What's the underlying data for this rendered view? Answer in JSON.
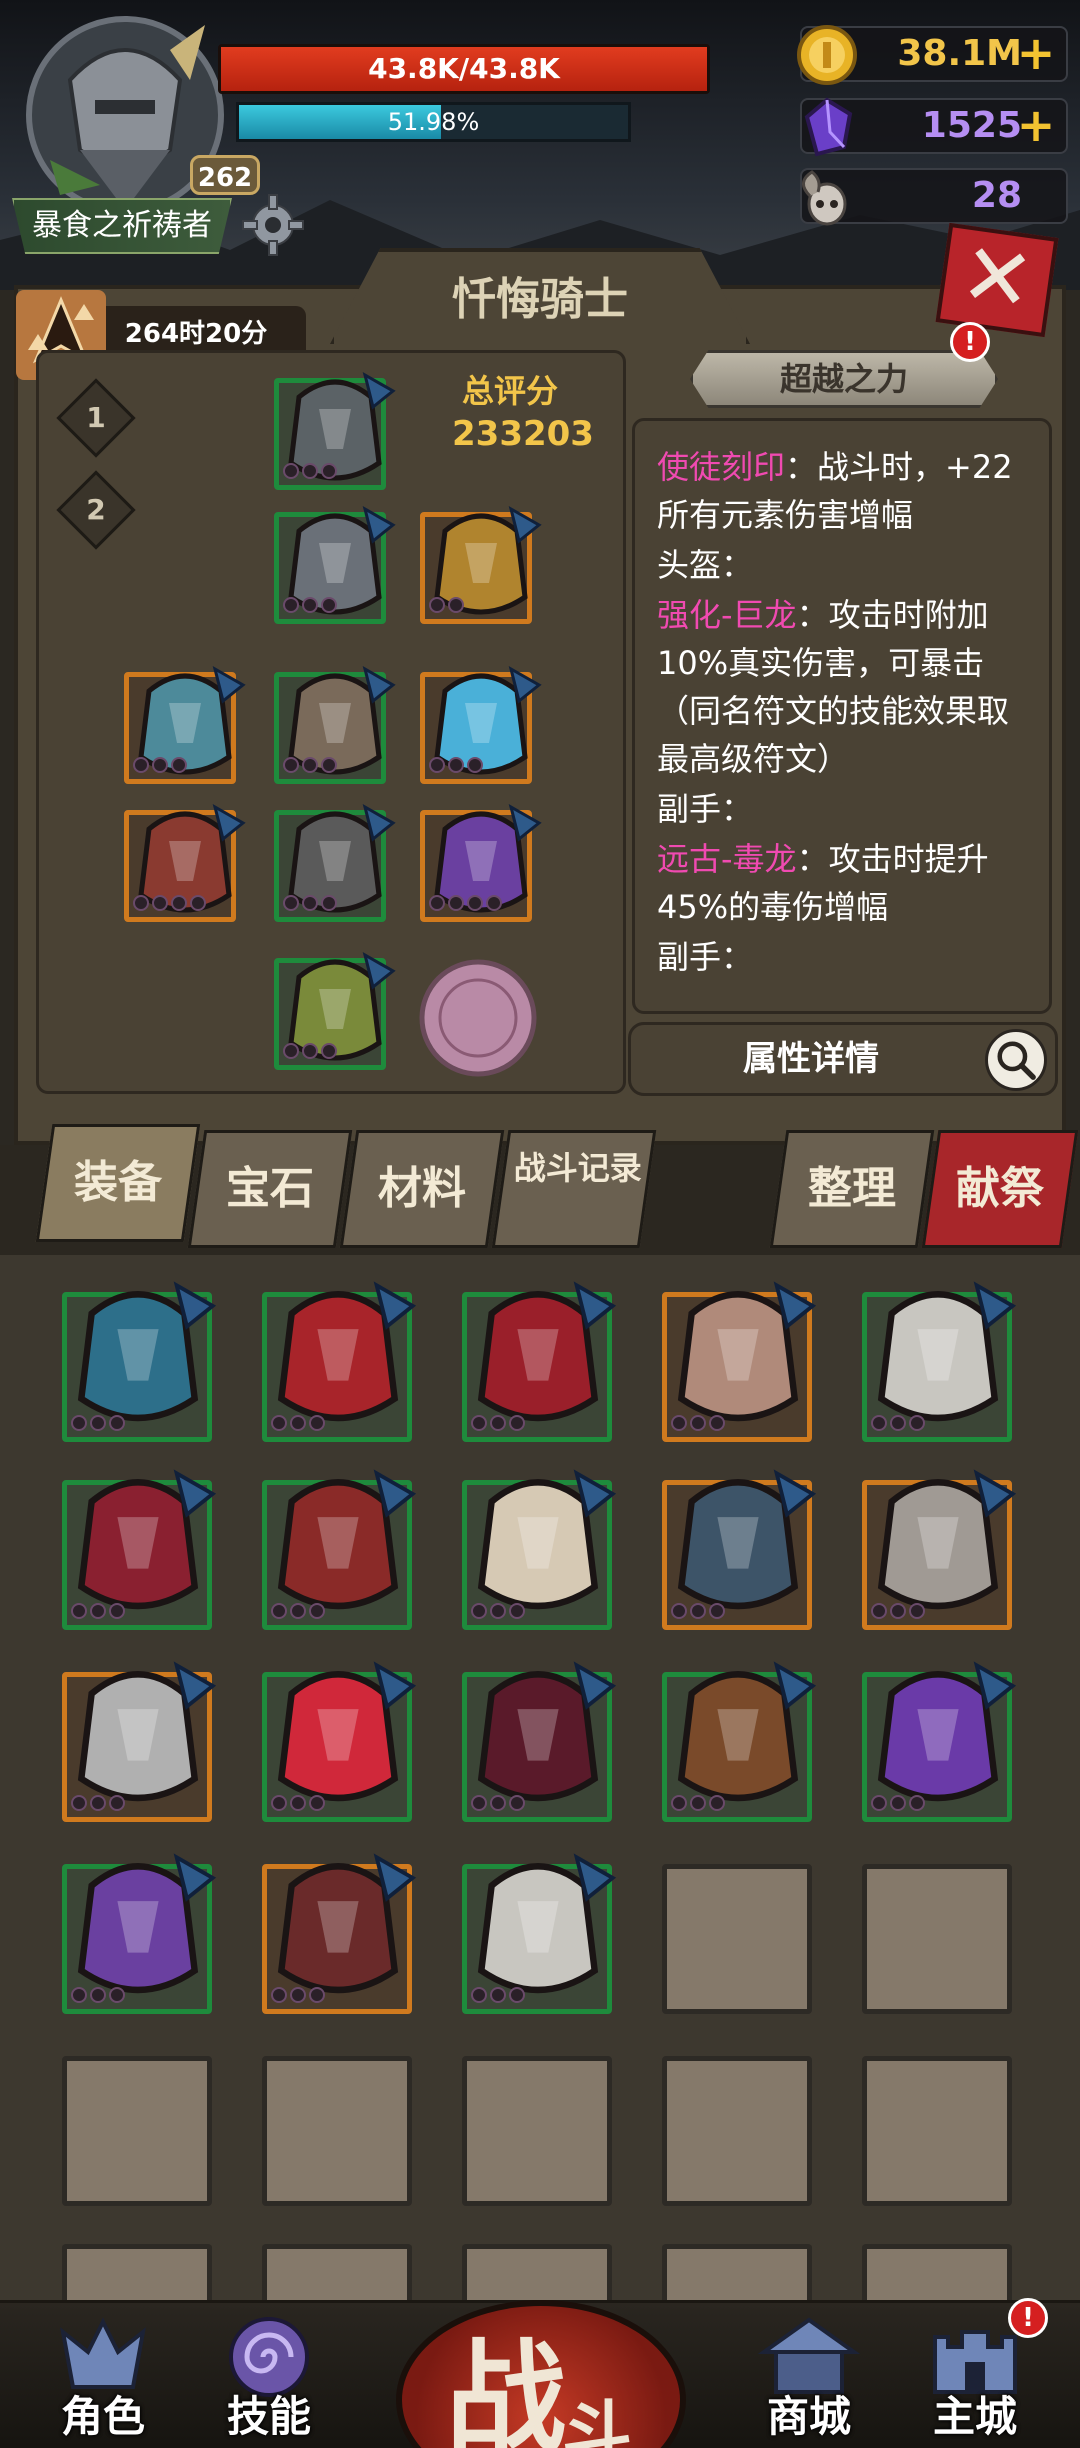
{
  "player": {
    "hp_text": "43.8K/43.8K",
    "hp_fraction": 1.0,
    "xp_text": "51.98%",
    "xp_fraction": 0.5198,
    "level": "262",
    "title": "暴食之祈祷者"
  },
  "currencies": [
    {
      "icon": "gold-coin-icon",
      "value": "38.1M",
      "color": "#f2c54a",
      "has_plus": true
    },
    {
      "icon": "purple-crystal-icon",
      "value": "1525",
      "color": "#b58ef2",
      "has_plus": true
    },
    {
      "icon": "ram-skull-icon",
      "value": "28",
      "color": "#b58ef2",
      "has_plus": false
    }
  ],
  "panel": {
    "title": "忏悔骑士",
    "timer": "264时20分",
    "presets": [
      "1",
      "2"
    ],
    "score_label": "总评分",
    "score_value": "233203",
    "transcend_label": "超越之力",
    "transcend_alert": "!",
    "attr_detail_label": "属性详情"
  },
  "desc": {
    "lines": [
      {
        "hl": "使徒刻印",
        "text": "：战斗时，+22所有元素伤害增幅"
      },
      {
        "hl": "",
        "text": "头盔："
      },
      {
        "hl": "强化-巨龙",
        "text": "：攻击时附加10%真实伤害，可暴击（同名符文的技能效果取最高级符文）"
      },
      {
        "hl": "",
        "text": "副手："
      },
      {
        "hl": "远古-毒龙",
        "text": "：攻击时提升45%的毒伤增幅"
      },
      {
        "hl": "",
        "text": "副手："
      }
    ]
  },
  "tabs": [
    {
      "label": "装备",
      "active": true
    },
    {
      "label": "宝石",
      "active": false
    },
    {
      "label": "材料",
      "active": false
    },
    {
      "label": "战斗记录",
      "active": false
    },
    {
      "label": "整理",
      "active": false
    },
    {
      "label": "献祭",
      "active": false
    }
  ],
  "inventory": {
    "rows": [
      [
        {
          "item": "blue-tome",
          "rarity": "green"
        },
        {
          "item": "red-tome",
          "rarity": "green"
        },
        {
          "item": "red-pauldrons",
          "rarity": "green"
        },
        {
          "item": "pearl-necklace",
          "rarity": "orange"
        },
        {
          "item": "steel-boots",
          "rarity": "green"
        }
      ],
      [
        {
          "item": "dragon-helm",
          "rarity": "green"
        },
        {
          "item": "dragon-armor",
          "rarity": "green"
        },
        {
          "item": "bone-armor",
          "rarity": "green"
        },
        {
          "item": "dragon-gauntlet",
          "rarity": "orange"
        },
        {
          "item": "ram-skull-helm",
          "rarity": "orange"
        }
      ],
      [
        {
          "item": "fire-axe",
          "rarity": "orange"
        },
        {
          "item": "crimson-star",
          "rarity": "green"
        },
        {
          "item": "dark-pauldrons",
          "rarity": "green"
        },
        {
          "item": "flame-belt",
          "rarity": "green"
        },
        {
          "item": "purple-helm",
          "rarity": "green"
        }
      ],
      [
        {
          "item": "void-boots",
          "rarity": "green"
        },
        {
          "item": "dragon-shield",
          "rarity": "orange"
        },
        {
          "item": "steel-greaves",
          "rarity": "green"
        },
        {
          "item": "",
          "rarity": "gray"
        },
        {
          "item": "",
          "rarity": "gray"
        }
      ],
      [
        {
          "item": "",
          "rarity": "gray"
        },
        {
          "item": "",
          "rarity": "gray"
        },
        {
          "item": "",
          "rarity": "gray"
        },
        {
          "item": "",
          "rarity": "gray"
        },
        {
          "item": "",
          "rarity": "gray"
        }
      ]
    ]
  },
  "nav": [
    {
      "label": "角色",
      "icon": "helmet-icon"
    },
    {
      "label": "技能",
      "icon": "swirl-icon"
    },
    {
      "label": "商城",
      "icon": "shop-icon"
    },
    {
      "label": "主城",
      "icon": "castle-icon",
      "alert": "!"
    }
  ],
  "battle": {
    "label1": "战",
    "label2": "斗"
  }
}
